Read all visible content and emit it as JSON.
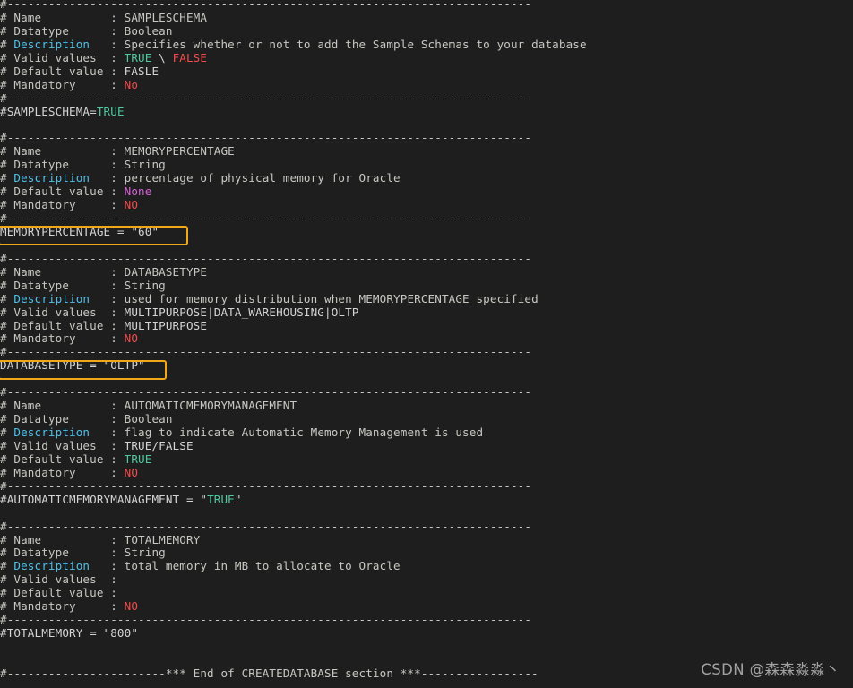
{
  "editor": {
    "background": "#1e1e1e",
    "foreground": "#d4d4d4",
    "highlight_color": "#f0a818",
    "separator": "#----------------------------------------------------------------------------",
    "blank": ""
  },
  "colors": {
    "comment": "#c8c8c2",
    "keyword": "#4fc1e9",
    "green": "#4ec9a0",
    "red": "#f14c4c",
    "magenta": "#d760d7",
    "plain": "#d4d4d4",
    "highlight_border": "#f0a818"
  },
  "labels": {
    "name": "# Name          : ",
    "datatype": "# Datatype      : ",
    "description_prefix": "# ",
    "description_word": "Description",
    "description_sep": "   : ",
    "valid_values": "# Valid values  : ",
    "default_value": "# Default value : ",
    "mandatory": "# Mandatory     : "
  },
  "sections": [
    {
      "id": "sampleschema",
      "name": "SAMPLESCHEMA",
      "datatype": "Boolean",
      "description": "Specifies whether or not to add the Sample Schemas to your database",
      "valid_values_parts": [
        {
          "text": "TRUE",
          "color": "green"
        },
        {
          "text": " \\ ",
          "color": "plain"
        },
        {
          "text": "FALSE",
          "color": "red"
        }
      ],
      "default_value": "FASLE",
      "default_value_color": "plain",
      "mandatory": "No",
      "mandatory_color": "red",
      "assignment_parts": [
        {
          "text": "#SAMPLESCHEMA=",
          "color": "plain"
        },
        {
          "text": "TRUE",
          "color": "green"
        }
      ],
      "highlighted": false
    },
    {
      "id": "memorypercentage",
      "name": "MEMORYPERCENTAGE",
      "datatype": "String",
      "description": "percentage of physical memory for Oracle",
      "valid_values_parts": null,
      "default_value": "None",
      "default_value_color": "magenta",
      "mandatory": "NO",
      "mandatory_color": "red",
      "assignment_parts": [
        {
          "text": "MEMORYPERCENTAGE = \"60\"",
          "color": "plain"
        }
      ],
      "highlighted": true
    },
    {
      "id": "databasetype",
      "name": "DATABASETYPE",
      "datatype": "String",
      "description": "used for memory distribution when MEMORYPERCENTAGE specified",
      "valid_values_parts": [
        {
          "text": "MULTIPURPOSE|DATA_WAREHOUSING|OLTP",
          "color": "plain"
        }
      ],
      "default_value": "MULTIPURPOSE",
      "default_value_color": "plain",
      "mandatory": "NO",
      "mandatory_color": "red",
      "assignment_parts": [
        {
          "text": "DATABASETYPE = \"OLTP\"",
          "color": "plain"
        }
      ],
      "highlighted": true
    },
    {
      "id": "automaticmemorymanagement",
      "name": "AUTOMATICMEMORYMANAGEMENT",
      "datatype": "Boolean",
      "description": "flag to indicate Automatic Memory Management is used",
      "valid_values_parts": [
        {
          "text": "TRUE/FALSE",
          "color": "plain"
        }
      ],
      "default_value": "TRUE",
      "default_value_color": "green",
      "mandatory": "NO",
      "mandatory_color": "red",
      "assignment_parts": [
        {
          "text": "#AUTOMATICMEMORYMANAGEMENT = \"",
          "color": "plain"
        },
        {
          "text": "TRUE",
          "color": "green"
        },
        {
          "text": "\"",
          "color": "plain"
        }
      ],
      "highlighted": false
    },
    {
      "id": "totalmemory",
      "name": "TOTALMEMORY",
      "datatype": "String",
      "description": "total memory in MB to allocate to Oracle",
      "valid_values_parts": [
        {
          "text": "",
          "color": "plain"
        }
      ],
      "default_value": "",
      "default_value_color": "plain",
      "mandatory": "NO",
      "mandatory_color": "red",
      "assignment_parts": [
        {
          "text": "#TOTALMEMORY = \"800\"",
          "color": "plain"
        }
      ],
      "highlighted": false
    }
  ],
  "footer": {
    "end_line": "#-----------------------*** End of CREATEDATABASE section ***-----------------"
  },
  "watermark": {
    "text": "CSDN @森森淼淼丶"
  }
}
